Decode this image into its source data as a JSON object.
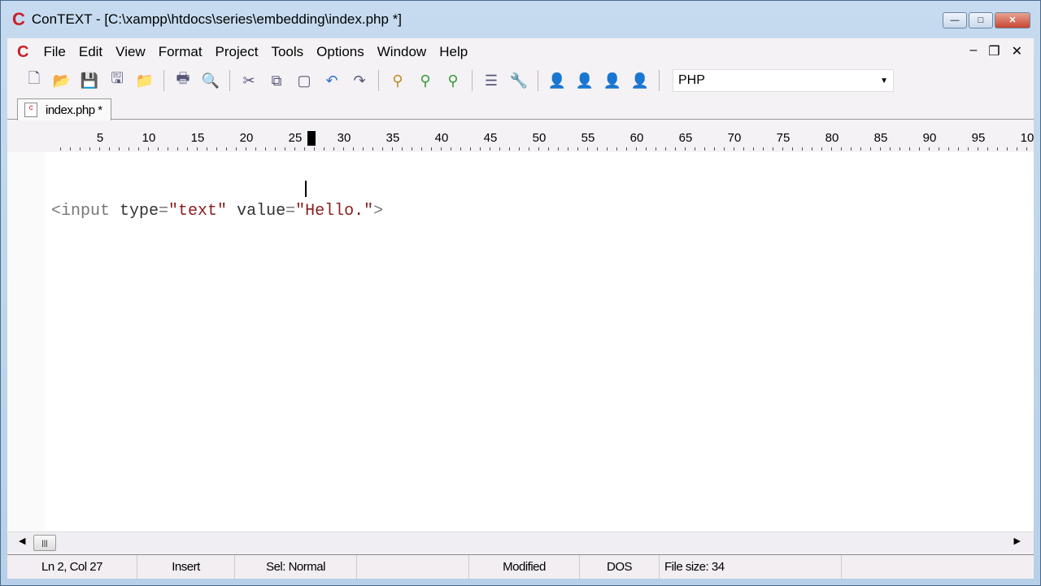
{
  "window": {
    "title": "ConTEXT - [C:\\xampp\\htdocs\\series\\embedding\\index.php *]",
    "logo": "C",
    "min": "—",
    "max": "□",
    "close": "✕"
  },
  "menu": [
    "File",
    "Edit",
    "View",
    "Format",
    "Project",
    "Tools",
    "Options",
    "Window",
    "Help"
  ],
  "mdi": {
    "min": "–",
    "restore": "❐",
    "close": "✕"
  },
  "toolbar": {
    "language": "PHP",
    "icons": [
      "new-file",
      "open",
      "save",
      "save-all",
      "open-folder",
      "print",
      "print-preview",
      "cut",
      "copy",
      "paste",
      "undo",
      "redo",
      "find",
      "find-next",
      "replace",
      "export",
      "tools",
      "user-1",
      "user-2",
      "user-3",
      "user-4"
    ]
  },
  "tab": {
    "label": "index.php *"
  },
  "ruler": [
    "5",
    "10",
    "15",
    "20",
    "25",
    "30",
    "35",
    "40",
    "45",
    "50",
    "55",
    "60",
    "65",
    "70",
    "75",
    "80",
    "85",
    "90",
    "95",
    "10"
  ],
  "code": {
    "open": "<input ",
    "a1": "type",
    "eq1": "=",
    "v1": "\"text\"",
    "sp": " ",
    "a2": "value",
    "eq2": "=",
    "v2": "\"Hello.\"",
    "close": ">"
  },
  "status": {
    "pos": "Ln 2, Col 27",
    "mode": "Insert",
    "sel": "Sel: Normal",
    "modified": "Modified",
    "eol": "DOS",
    "size": "File size: 34"
  }
}
